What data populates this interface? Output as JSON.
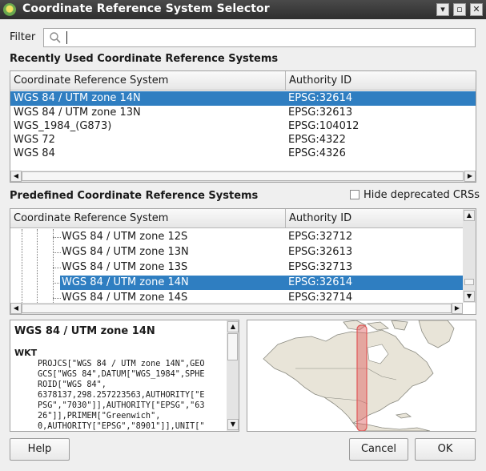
{
  "window": {
    "title": "Coordinate Reference System Selector",
    "controls": [
      "▾",
      "▫",
      "✕"
    ]
  },
  "filter": {
    "label": "Filter",
    "value": ""
  },
  "recent": {
    "title": "Recently Used Coordinate Reference Systems",
    "columns": [
      "Coordinate Reference System",
      "Authority ID"
    ],
    "rows": [
      {
        "name": "WGS 84 / UTM zone 14N",
        "id": "EPSG:32614"
      },
      {
        "name": "WGS 84 / UTM zone 13N",
        "id": "EPSG:32613"
      },
      {
        "name": "WGS_1984_(G873)",
        "id": "EPSG:104012"
      },
      {
        "name": "WGS 72",
        "id": "EPSG:4322"
      },
      {
        "name": "WGS 84",
        "id": "EPSG:4326"
      }
    ]
  },
  "predefined": {
    "title": "Predefined Coordinate Reference Systems",
    "hide_deprecated_label": "Hide deprecated CRSs",
    "hide_deprecated_checked": false,
    "columns": [
      "Coordinate Reference System",
      "Authority ID"
    ],
    "rows": [
      {
        "name": "WGS 84 / UTM zone 12S",
        "id": "EPSG:32712"
      },
      {
        "name": "WGS 84 / UTM zone 13N",
        "id": "EPSG:32613"
      },
      {
        "name": "WGS 84 / UTM zone 13S",
        "id": "EPSG:32713"
      },
      {
        "name": "WGS 84 / UTM zone 14N",
        "id": "EPSG:32614"
      },
      {
        "name": "WGS 84 / UTM zone 14S",
        "id": "EPSG:32714"
      }
    ]
  },
  "details": {
    "name": "WGS 84 / UTM zone 14N",
    "wkt_label": "WKT",
    "wkt_lines": [
      "PROJCS[\"WGS 84 / UTM zone 14N\",GEO",
      "GCS[\"WGS 84\",DATUM[\"WGS_1984\",SPHE",
      "ROID[\"WGS 84\",",
      "6378137,298.257223563,AUTHORITY[\"E",
      "PSG\",\"7030\"]],AUTHORITY[\"EPSG\",\"63",
      "26\"]],PRIMEM[\"Greenwich\",",
      "0,AUTHORITY[\"EPSG\",\"8901\"]],UNIT[\""
    ]
  },
  "buttons": {
    "help": "Help",
    "cancel": "Cancel",
    "ok": "OK"
  },
  "colors": {
    "selection": "#2f7ec1",
    "extent": "#e05a5a",
    "land": "#e8e4d8"
  }
}
